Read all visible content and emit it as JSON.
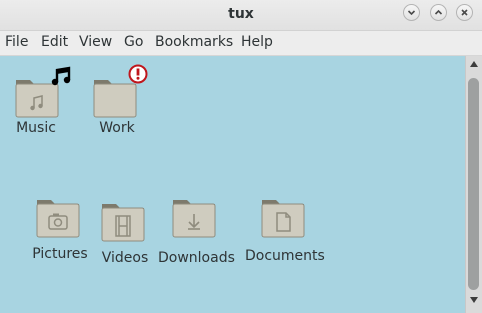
{
  "window": {
    "title": "tux"
  },
  "menu": {
    "items": [
      "File",
      "Edit",
      "View",
      "Go",
      "Bookmarks",
      "Help"
    ]
  },
  "icons": [
    {
      "label": "Music",
      "emblem": "music-note",
      "overlay": "music-note-emblem"
    },
    {
      "label": "Work",
      "emblem": "",
      "overlay": "important-emblem"
    },
    {
      "label": "Pictures",
      "emblem": "camera"
    },
    {
      "label": "Videos",
      "emblem": "film"
    },
    {
      "label": "Downloads",
      "emblem": "download"
    },
    {
      "label": "Documents",
      "emblem": "document"
    }
  ],
  "colors": {
    "desktop_bg": "#a8d4e1",
    "folder_body": "#cfccbf",
    "folder_tab": "#7d7a6c",
    "important_emblem": "#c0161c"
  }
}
